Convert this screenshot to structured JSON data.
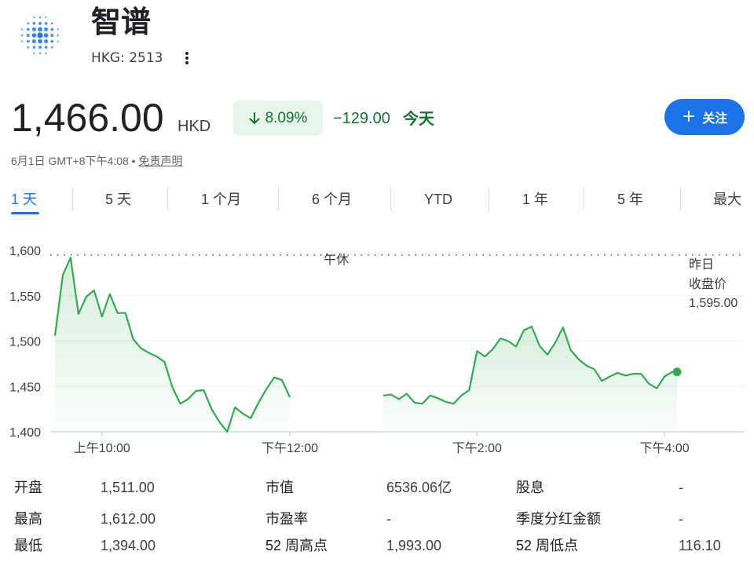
{
  "header": {
    "company_name": "智谱",
    "ticker": "HKG: 2513",
    "logo_icon": "dot-grid-logo-icon",
    "more_icon": "more-vert-icon"
  },
  "quote": {
    "price": "1,466.00",
    "currency": "HKD",
    "change_pct": "8.09%",
    "change_abs": "−129.00",
    "change_period": "今天",
    "direction_icon": "arrow-down-icon",
    "change_color": "#137333"
  },
  "follow": {
    "label": "关注",
    "icon": "plus-icon",
    "color": "#1a73e8"
  },
  "meta": {
    "timestamp": "6月1日 GMT+8下午4:08",
    "separator": "•",
    "disclaimer": "免责声明"
  },
  "tabs": [
    {
      "label": "1 天",
      "active": true
    },
    {
      "label": "5 天"
    },
    {
      "label": "1 个月"
    },
    {
      "label": "6 个月"
    },
    {
      "label": "YTD"
    },
    {
      "label": "1 年"
    },
    {
      "label": "5 年"
    },
    {
      "label": "最大"
    }
  ],
  "chart_data": {
    "type": "line",
    "title": "",
    "xlabel": "",
    "ylabel": "",
    "ylim": [
      1400,
      1600
    ],
    "yticks": [
      "1,600",
      "1,550",
      "1,500",
      "1,450",
      "1,400"
    ],
    "xticks": [
      "上午10:00",
      "下午12:00",
      "下午2:00",
      "下午4:00"
    ],
    "lunch_break_label": "午休",
    "prev_close_label_1": "昨日",
    "prev_close_label_2": "收盘价",
    "prev_close_value": "1,595.00",
    "prev_close": 1595,
    "line_color": "#34a853",
    "grid": true,
    "morning_session": {
      "x": [
        "9:30",
        "9:35",
        "9:40",
        "9:45",
        "9:50",
        "9:55",
        "10:00",
        "10:05",
        "10:10",
        "10:15",
        "10:20",
        "10:25",
        "10:30",
        "10:35",
        "10:40",
        "10:45",
        "10:50",
        "10:55",
        "11:00",
        "11:05",
        "11:10",
        "11:15",
        "11:20",
        "11:25",
        "11:30",
        "11:35",
        "11:40",
        "11:45",
        "11:50",
        "11:55",
        "12:00"
      ],
      "y": [
        1506,
        1573,
        1592,
        1530,
        1549,
        1556,
        1527,
        1552,
        1531,
        1531,
        1502,
        1492,
        1487,
        1483,
        1477,
        1449,
        1431,
        1436,
        1445,
        1446,
        1425,
        1411,
        1400,
        1427,
        1420,
        1415,
        1432,
        1447,
        1460,
        1457,
        1438
      ]
    },
    "afternoon_session": {
      "x": [
        "13:00",
        "13:05",
        "13:10",
        "13:15",
        "13:20",
        "13:25",
        "13:30",
        "13:35",
        "13:40",
        "13:45",
        "13:50",
        "13:55",
        "14:00",
        "14:05",
        "14:10",
        "14:15",
        "14:20",
        "14:25",
        "14:30",
        "14:35",
        "14:40",
        "14:45",
        "14:50",
        "14:55",
        "15:00",
        "15:05",
        "15:10",
        "15:15",
        "15:20",
        "15:25",
        "15:30",
        "15:35",
        "15:40",
        "15:45",
        "15:50",
        "15:55",
        "16:00",
        "16:05",
        "16:08"
      ],
      "y": [
        1440,
        1441,
        1436,
        1442,
        1432,
        1431,
        1440,
        1437,
        1433,
        1431,
        1440,
        1446,
        1489,
        1483,
        1491,
        1503,
        1500,
        1494,
        1512,
        1516,
        1495,
        1485,
        1498,
        1515,
        1490,
        1480,
        1473,
        1469,
        1456,
        1461,
        1465,
        1462,
        1464,
        1464,
        1453,
        1448,
        1461,
        1466,
        1466
      ]
    }
  },
  "stats": {
    "col1": [
      {
        "label": "开盘",
        "value": "1,511.00"
      },
      {
        "label": "最高",
        "value": "1,612.00"
      },
      {
        "label": "最低",
        "value": "1,394.00"
      }
    ],
    "col2": [
      {
        "label": "市值",
        "value": "6536.06亿"
      },
      {
        "label": "市盈率",
        "value": "-"
      },
      {
        "label": "52 周高点",
        "value": "1,993.00"
      }
    ],
    "col3": [
      {
        "label": "股息",
        "value": "-"
      },
      {
        "label": "季度分红金额",
        "value": "-"
      },
      {
        "label": "52 周低点",
        "value": "116.10"
      }
    ]
  }
}
